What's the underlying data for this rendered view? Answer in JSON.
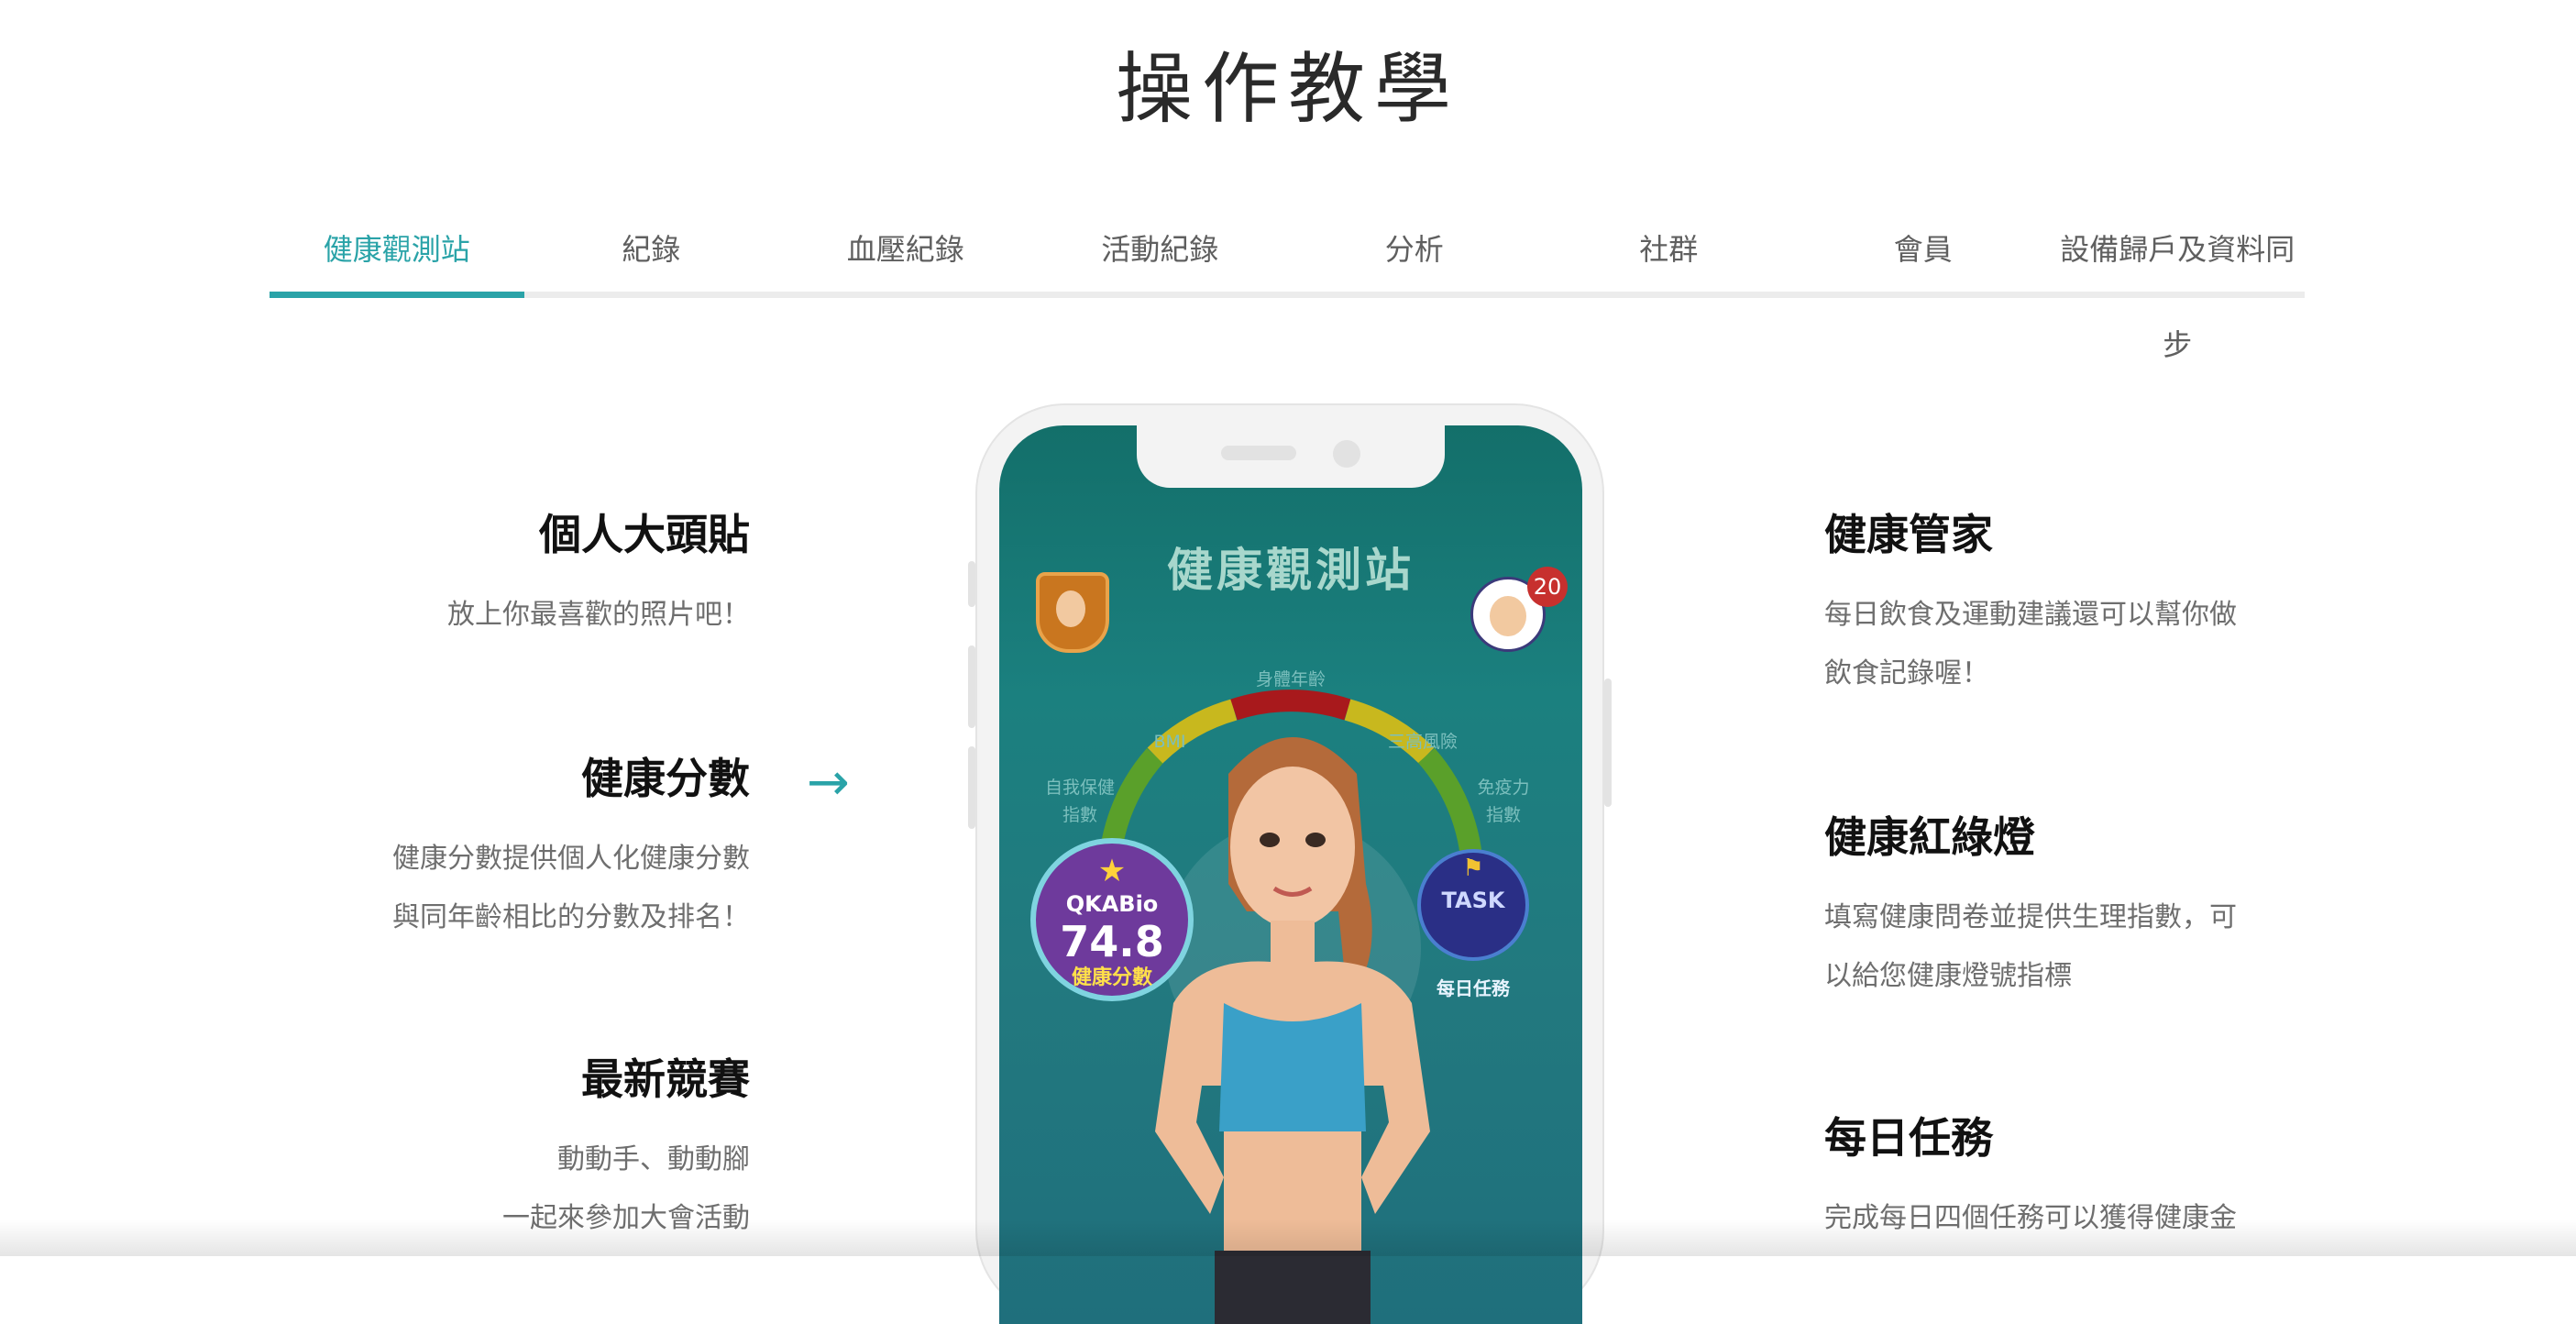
{
  "page": {
    "title": "操作教學"
  },
  "tabs": [
    {
      "label": "健康觀測站",
      "active": true
    },
    {
      "label": "紀錄",
      "active": false
    },
    {
      "label": "血壓紀錄",
      "active": false
    },
    {
      "label": "活動紀錄",
      "active": false
    },
    {
      "label": "分析",
      "active": false
    },
    {
      "label": "社群",
      "active": false
    },
    {
      "label": "會員",
      "active": false
    },
    {
      "label": "設備歸戶及資料同步",
      "active": false
    }
  ],
  "left_features": [
    {
      "title": "個人大頭貼",
      "lines": [
        "放上你最喜歡的照片吧！"
      ]
    },
    {
      "title": "健康分數",
      "lines": [
        "健康分數提供個人化健康分數",
        "與同年齡相比的分數及排名！"
      ]
    },
    {
      "title": "最新競賽",
      "lines": [
        "動動手、動動腳",
        "一起來參加大會活動"
      ]
    }
  ],
  "right_features": [
    {
      "title": "健康管家",
      "lines": [
        "每日飲食及運動建議還可以幫你做",
        "飲食記錄喔！"
      ]
    },
    {
      "title": "健康紅綠燈",
      "lines": [
        "填寫健康問卷並提供生理指數，可",
        "以給您健康燈號指標"
      ]
    },
    {
      "title": "每日任務",
      "lines": [
        "完成每日四個任務可以獲得健康金"
      ]
    }
  ],
  "arrow": "→",
  "phone": {
    "screen_title": "健康觀測站",
    "notification_count": "20",
    "gauge_labels": {
      "top": "身體年齡",
      "left_upper": "BMI",
      "right_upper": "三高風險",
      "left_lower_1": "自我保健",
      "left_lower_2": "指數",
      "right_lower_1": "免疫力",
      "right_lower_2": "指數"
    },
    "score": {
      "brand": "QKABio",
      "value": "74.8",
      "label": "健康分數"
    },
    "task": {
      "title": "TASK",
      "label": "每日任務"
    }
  },
  "colors": {
    "accent": "#2aa3a8",
    "screen": "#1b807f",
    "score": "#6e3a9c",
    "task": "#2a2f86"
  },
  "icons": [
    "arrow-right-icon",
    "avatar-badge-icon",
    "nurse-avatar-icon",
    "star-icon",
    "flag-icon"
  ]
}
